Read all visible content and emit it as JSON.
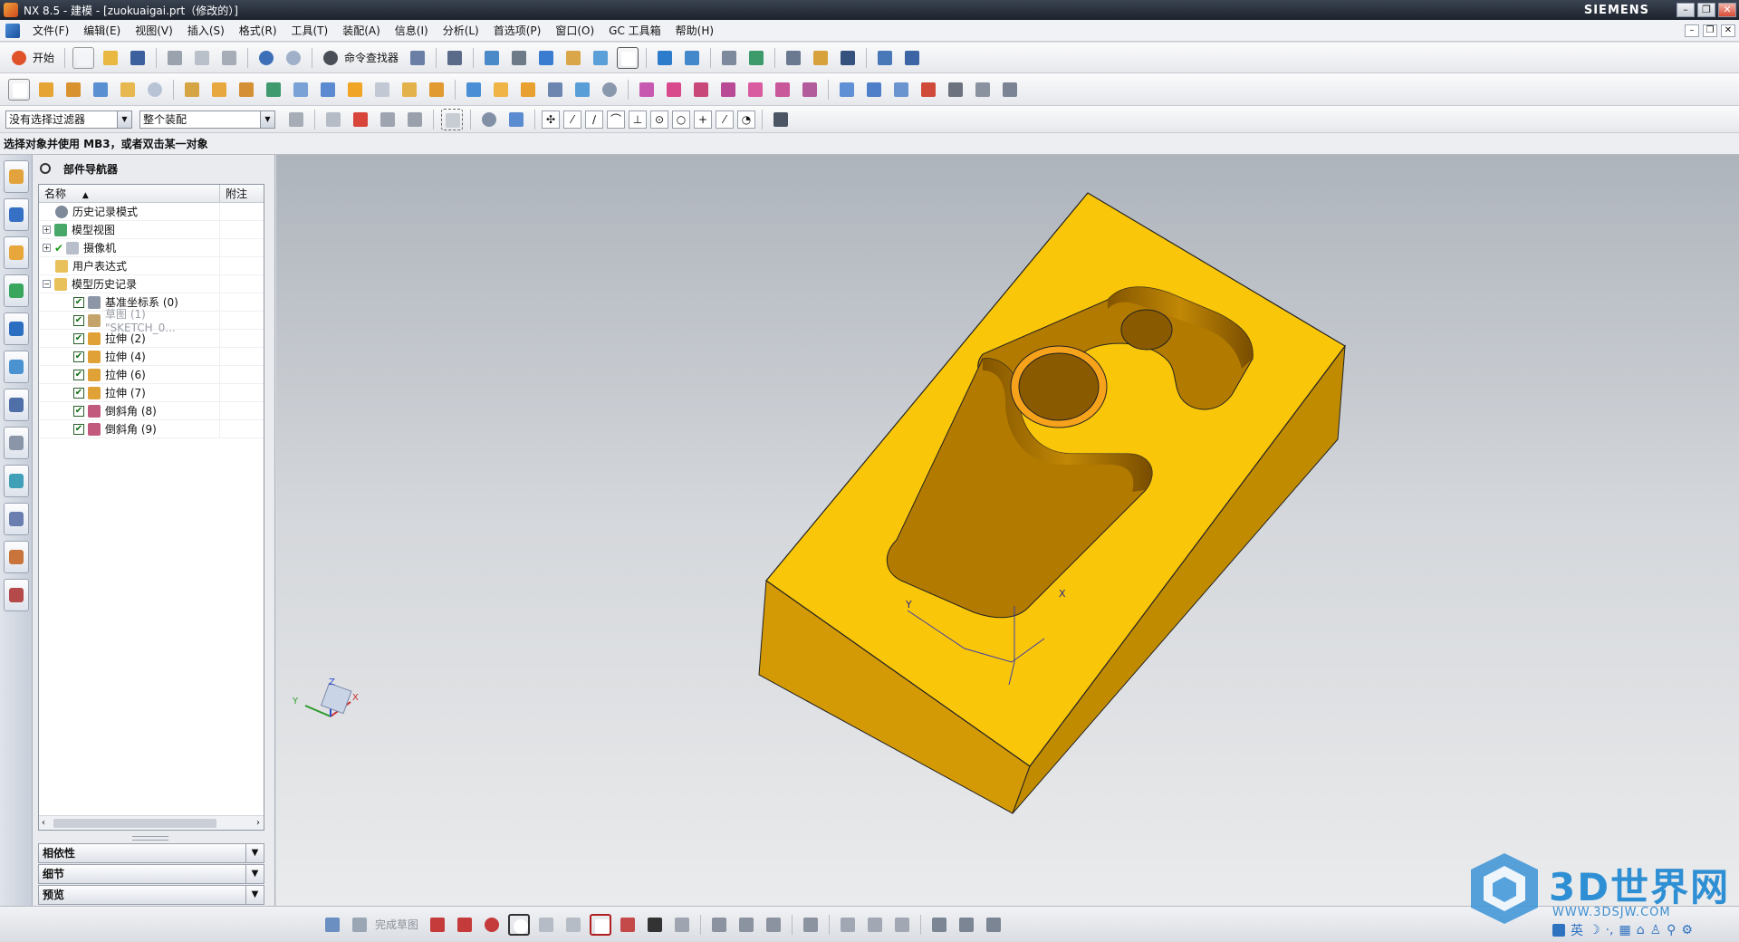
{
  "window": {
    "title": "NX 8.5 - 建模 - [zuokuaigai.prt（修改的）]",
    "brand": "SIEMENS",
    "controls": [
      "–",
      "❐",
      "✕"
    ]
  },
  "menu": {
    "items": [
      "文件(F)",
      "编辑(E)",
      "视图(V)",
      "插入(S)",
      "格式(R)",
      "工具(T)",
      "装配(A)",
      "信息(I)",
      "分析(L)",
      "首选项(P)",
      "窗口(O)",
      "GC 工具箱",
      "帮助(H)"
    ]
  },
  "toolbar": {
    "start_label": "开始",
    "command_finder_label": "命令查找器"
  },
  "selection_bar": {
    "filter_value": "没有选择过滤器",
    "scope_value": "整个装配"
  },
  "status": {
    "prompt": "选择对象并使用 MB3，或者双击某一对象"
  },
  "navigator": {
    "title": "部件导航器",
    "col_name": "名称",
    "col_note": "附注",
    "rows": [
      {
        "label": "历史记录模式",
        "icon": "clock-icon"
      },
      {
        "label": "模型视图",
        "icon": "views-icon",
        "expander": "+"
      },
      {
        "label": "摄像机",
        "icon": "camera-icon",
        "expander": "+",
        "check": "✔"
      },
      {
        "label": "用户表达式",
        "icon": "folder-icon"
      },
      {
        "label": "模型历史记录",
        "icon": "folder-icon",
        "expander": "−"
      },
      {
        "label": "基准坐标系 (0)",
        "icon": "datum-csys-icon",
        "check": "✔"
      },
      {
        "label": "草图 (1) \"SKETCH_0...",
        "icon": "sketch-icon",
        "check": "✔"
      },
      {
        "label": "拉伸 (2)",
        "icon": "extrude-icon",
        "check": "✔"
      },
      {
        "label": "拉伸 (4)",
        "icon": "extrude-icon",
        "check": "✔"
      },
      {
        "label": "拉伸 (6)",
        "icon": "extrude-icon",
        "check": "✔"
      },
      {
        "label": "拉伸 (7)",
        "icon": "extrude-icon",
        "check": "✔"
      },
      {
        "label": "倒斜角 (8)",
        "icon": "chamfer-icon",
        "check": "✔"
      },
      {
        "label": "倒斜角 (9)",
        "icon": "chamfer-icon",
        "check": "✔"
      }
    ],
    "panels": [
      "相依性",
      "细节",
      "预览"
    ]
  },
  "sketch_bar": {
    "finish_label": "完成草图"
  },
  "model": {
    "part_color": "#f9c60a",
    "side_dark_color": "#c18b00",
    "side_mid_color": "#d49a06",
    "pocket_color": "#b37a00"
  },
  "watermark": {
    "title": "3D世界网",
    "url": "WWW.3DSJW.COM",
    "ime_lang": "英"
  }
}
